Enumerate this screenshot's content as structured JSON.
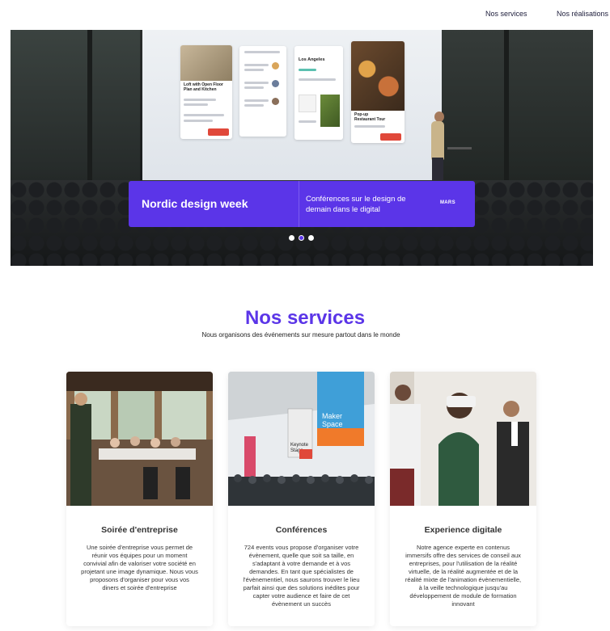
{
  "nav": {
    "items": [
      {
        "label": "Nos services"
      },
      {
        "label": "Nos réalisations"
      }
    ]
  },
  "hero": {
    "event_title": "Nordic design week",
    "event_description": "Conférences sur le design de demain dans le digital",
    "event_month": "MARS",
    "slides": 3,
    "active_slide": 2,
    "screen": {
      "card1_title": "Loft with Open Floor Plan and Kitchen",
      "card2_title": "Los Angeles",
      "card3_title": "Pop-up Restaurant Tour"
    },
    "accent_color": "#5b35e8"
  },
  "services": {
    "title": "Nos services",
    "subtitle": "Nous organisons des événements sur mesure partout dans le monde",
    "cards": [
      {
        "title": "Soirée d'entreprise",
        "text": "Une soirée d'entreprise vous permet de réunir vos équipes pour un moment convivial afin de valoriser votre société en projetant une image dynamique. Nous vous proposons d'organiser pour vous vos diners et soirée d'entreprise"
      },
      {
        "title": "Conférences",
        "text": "724 events vous propose d'organiser votre évènement, quelle que soit sa taille, en s'adaptant à votre demande et à vos demandes. En tant que spécialistes de l'évènementiel, nous saurons trouver le lieu parfait ainsi que des solutions inédites pour capter votre audience et faire de cet évènement un succès",
        "sign_maker": "Maker Space",
        "sign_keynote": "Keynote Stage"
      },
      {
        "title": "Experience digitale",
        "text": "Notre agence experte en contenus immersifs offre des services de conseil aux entreprises, pour l'utilisation de la réalité virtuelle, de la réalité augmentée et de la réalité mixte de l'animation évènementielle, à la veille technologique jusqu'au développement de module de formation innovant"
      }
    ]
  }
}
